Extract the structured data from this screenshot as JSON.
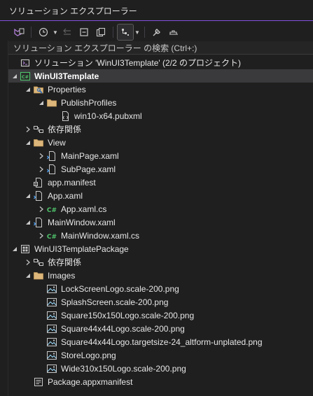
{
  "window": {
    "title": "ソリューション エクスプローラー"
  },
  "search": {
    "placeholder": "ソリューション エクスプローラー の検索 (Ctrl+:)"
  },
  "colors": {
    "accent": "#8250df",
    "background": "#1f1f1f",
    "selected_row": "#3a3a3d"
  },
  "toolbar": [
    "vs-switch-views-icon",
    "history-icon",
    "back-icon",
    "collapse-all-icon",
    "show-all-files-icon",
    "filter-icon",
    "properties-wrench-icon",
    "preview-icon"
  ],
  "tree": [
    {
      "label": "ソリューション 'WinUI3Template' (2/2 のプロジェクト)",
      "icon": "solution-icon",
      "level": 0,
      "expander": "none",
      "selected": false
    },
    {
      "label": "WinUI3Template",
      "icon": "csharp-project-icon",
      "level": 0,
      "expander": "expanded",
      "selected": true
    },
    {
      "label": "Properties",
      "icon": "properties-folder-icon",
      "level": 1,
      "expander": "expanded"
    },
    {
      "label": "PublishProfiles",
      "icon": "folder-icon",
      "level": 2,
      "expander": "expanded"
    },
    {
      "label": "win10-x64.pubxml",
      "icon": "xml-file-icon",
      "level": 3,
      "expander": "none"
    },
    {
      "label": "依存関係",
      "icon": "dependencies-icon",
      "level": 1,
      "expander": "collapsed"
    },
    {
      "label": "View",
      "icon": "folder-icon",
      "level": 1,
      "expander": "expanded"
    },
    {
      "label": "MainPage.xaml",
      "icon": "xaml-file-icon",
      "level": 2,
      "expander": "collapsed"
    },
    {
      "label": "SubPage.xaml",
      "icon": "xaml-file-icon",
      "level": 2,
      "expander": "collapsed"
    },
    {
      "label": "app.manifest",
      "icon": "manifest-icon",
      "level": 1,
      "expander": "none"
    },
    {
      "label": "App.xaml",
      "icon": "xaml-file-icon",
      "level": 1,
      "expander": "expanded"
    },
    {
      "label": "App.xaml.cs",
      "icon": "csharp-file-icon",
      "level": 2,
      "expander": "collapsed"
    },
    {
      "label": "MainWindow.xaml",
      "icon": "xaml-file-icon",
      "level": 1,
      "expander": "expanded"
    },
    {
      "label": "MainWindow.xaml.cs",
      "icon": "csharp-file-icon",
      "level": 2,
      "expander": "collapsed"
    },
    {
      "label": "WinUI3TemplatePackage",
      "icon": "package-project-icon",
      "level": 0,
      "expander": "expanded"
    },
    {
      "label": "依存関係",
      "icon": "dependencies-icon",
      "level": 1,
      "expander": "collapsed"
    },
    {
      "label": "Images",
      "icon": "folder-icon",
      "level": 1,
      "expander": "expanded"
    },
    {
      "label": "LockScreenLogo.scale-200.png",
      "icon": "image-file-icon",
      "level": 2,
      "expander": "none"
    },
    {
      "label": "SplashScreen.scale-200.png",
      "icon": "image-file-icon",
      "level": 2,
      "expander": "none"
    },
    {
      "label": "Square150x150Logo.scale-200.png",
      "icon": "image-file-icon",
      "level": 2,
      "expander": "none"
    },
    {
      "label": "Square44x44Logo.scale-200.png",
      "icon": "image-file-icon",
      "level": 2,
      "expander": "none"
    },
    {
      "label": "Square44x44Logo.targetsize-24_altform-unplated.png",
      "icon": "image-file-icon",
      "level": 2,
      "expander": "none"
    },
    {
      "label": "StoreLogo.png",
      "icon": "image-file-icon",
      "level": 2,
      "expander": "none"
    },
    {
      "label": "Wide310x150Logo.scale-200.png",
      "icon": "image-file-icon",
      "level": 2,
      "expander": "none"
    },
    {
      "label": "Package.appxmanifest",
      "icon": "appxmanifest-icon",
      "level": 1,
      "expander": "none"
    }
  ]
}
